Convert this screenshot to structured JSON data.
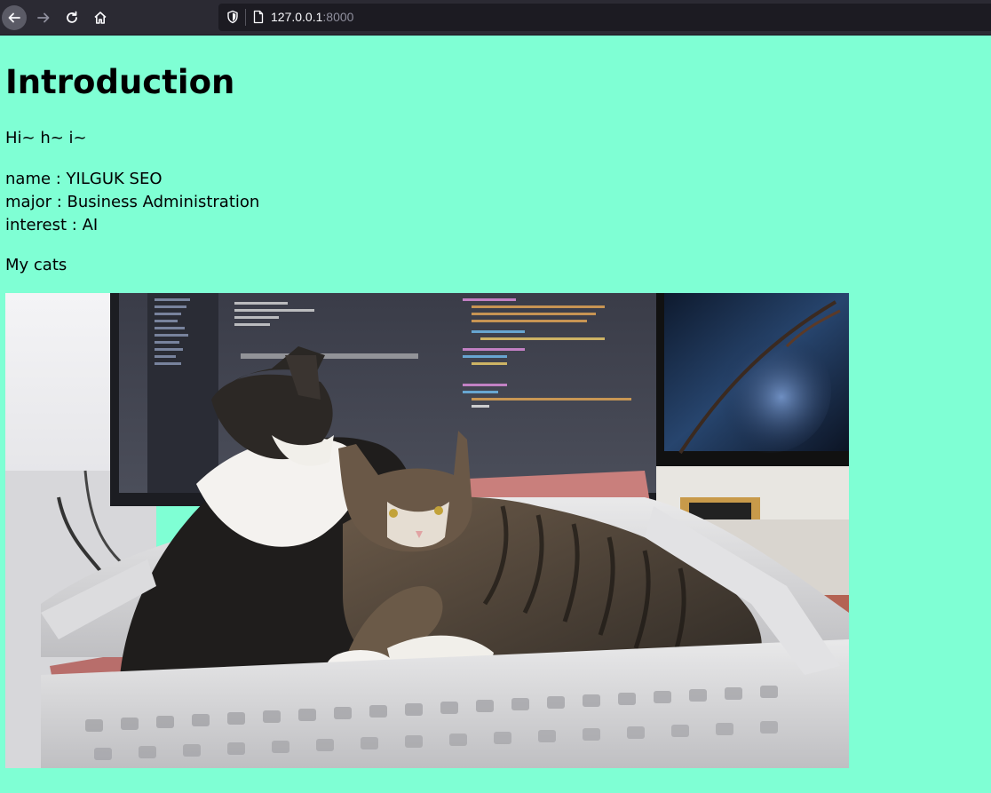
{
  "browser": {
    "url_host": "127.0.0.1",
    "url_port": ":8000"
  },
  "page": {
    "title": "Introduction",
    "greeting": "Hi~ h~ i~",
    "profile": {
      "name_line": "name : YILGUK SEO",
      "major_line": "major : Business Administration",
      "interest_line": "interest : AI"
    },
    "cats_caption": "My cats"
  },
  "colors": {
    "page_background": "#7fffd4",
    "browser_chrome": "#2b2a33",
    "url_field": "#1c1b22"
  },
  "icons": [
    "back-arrow-icon",
    "forward-arrow-icon",
    "reload-icon",
    "home-icon",
    "shield-icon",
    "page-icon"
  ]
}
